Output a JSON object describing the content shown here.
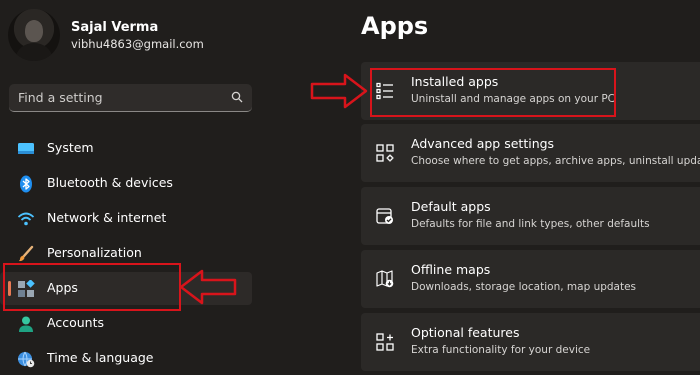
{
  "user": {
    "name": "Sajal Verma",
    "email": "vibhu4863@gmail.com"
  },
  "search": {
    "placeholder": "Find a setting"
  },
  "sidebar": {
    "items": [
      {
        "label": "System",
        "icon": "monitor-icon"
      },
      {
        "label": "Bluetooth & devices",
        "icon": "bluetooth-icon"
      },
      {
        "label": "Network & internet",
        "icon": "wifi-icon"
      },
      {
        "label": "Personalization",
        "icon": "brush-icon"
      },
      {
        "label": "Apps",
        "icon": "apps-icon",
        "selected": true
      },
      {
        "label": "Accounts",
        "icon": "person-icon"
      },
      {
        "label": "Time & language",
        "icon": "globe-clock-icon"
      }
    ]
  },
  "main": {
    "title": "Apps",
    "cards": [
      {
        "title": "Installed apps",
        "subtitle": "Uninstall and manage apps on your PC",
        "icon": "list-icon"
      },
      {
        "title": "Advanced app settings",
        "subtitle": "Choose where to get apps, archive apps, uninstall updates",
        "icon": "app-settings-icon"
      },
      {
        "title": "Default apps",
        "subtitle": "Defaults for file and link types, other defaults",
        "icon": "default-apps-icon"
      },
      {
        "title": "Offline maps",
        "subtitle": "Downloads, storage location, map updates",
        "icon": "map-icon"
      },
      {
        "title": "Optional features",
        "subtitle": "Extra functionality for your device",
        "icon": "optional-features-icon"
      }
    ]
  },
  "colors": {
    "background": "#201e1c",
    "card": "#2b2927",
    "accent": "#e87a55",
    "annotation": "#d8141b"
  }
}
